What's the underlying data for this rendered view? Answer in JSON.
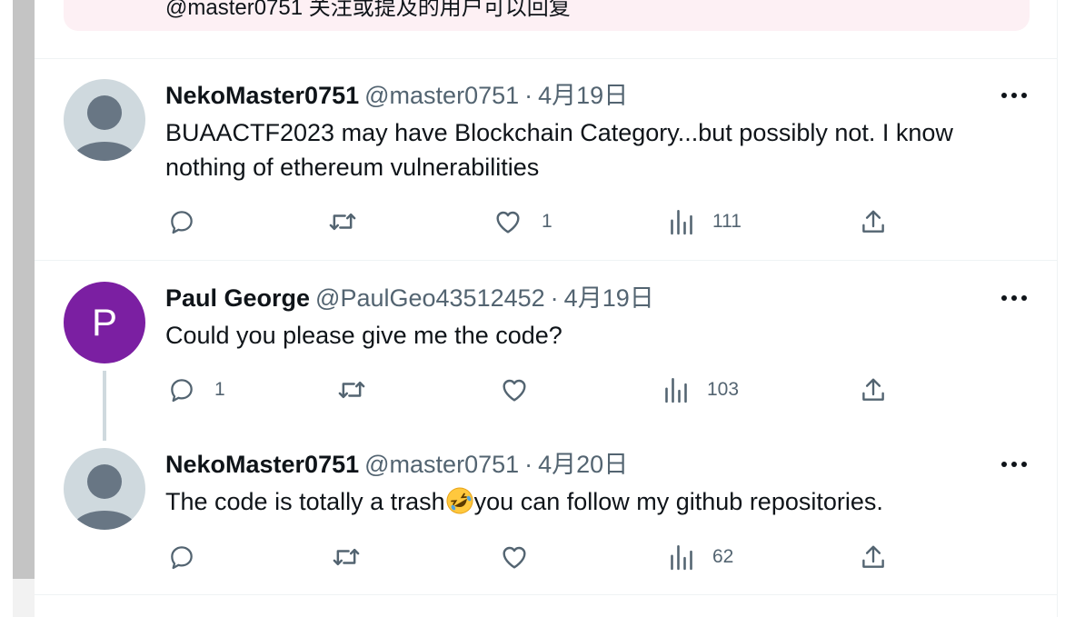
{
  "notice": {
    "text": "@master0751 关注或提及的用户可以回复"
  },
  "tweets": [
    {
      "name": "NekoMaster0751",
      "handle": "@master0751",
      "date": "4月19日",
      "text": "BUAACTF2023 may have Blockchain Category...but possibly not. I know nothing of ethereum vulnerabilities",
      "replies": "",
      "retweets": "",
      "likes": "1",
      "views": "111"
    },
    {
      "name": "Paul George",
      "handle": "@PaulGeo43512452",
      "date": "4月19日",
      "avatar_letter": "P",
      "avatar_color": "#7b1fa2",
      "text": "Could you please give me the code?",
      "replies": "1",
      "retweets": "",
      "likes": "",
      "views": "103"
    },
    {
      "name": "NekoMaster0751",
      "handle": "@master0751",
      "date": "4月20日",
      "text_before_emoji": "The code is totally a trash",
      "emoji": "rolling-on-floor-laughing",
      "text_after_emoji": "you can follow my github repositories.",
      "replies": "",
      "retweets": "",
      "likes": "",
      "views": "62"
    }
  ],
  "separator": "·",
  "colors": {
    "text_primary": "#0f1419",
    "text_secondary": "#536471",
    "divider": "#eff3f4",
    "notice_bg": "#fdf0f4",
    "avatar_default": "#cfd9de"
  },
  "icons": [
    "reply-icon",
    "retweet-icon",
    "like-icon",
    "views-icon",
    "share-icon",
    "more-icon",
    "default-avatar-icon"
  ]
}
